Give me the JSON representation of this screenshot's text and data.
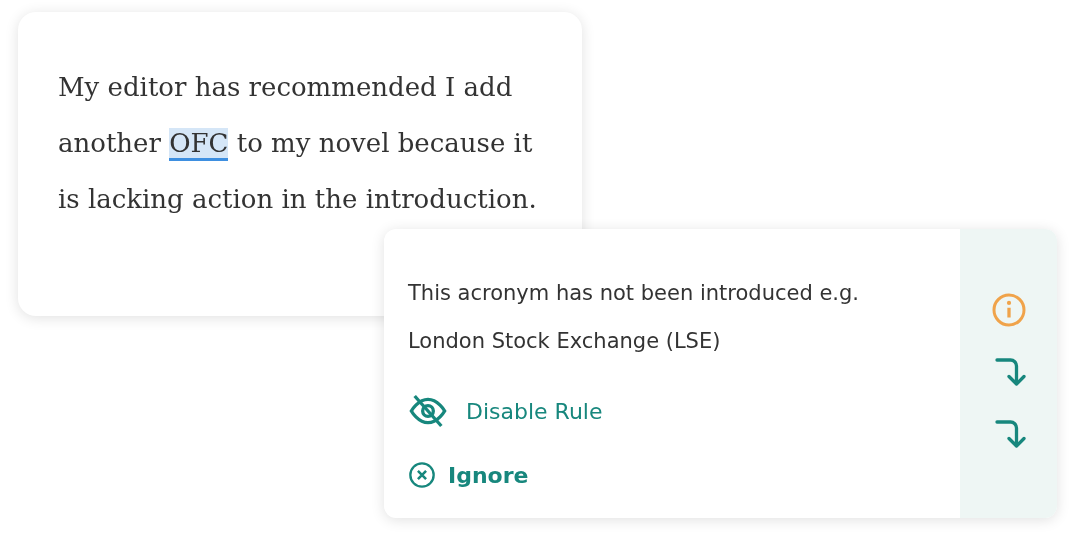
{
  "editor": {
    "segments": [
      {
        "text": "My editor has recommended I add another ",
        "highlighted": false
      },
      {
        "text": "OFC",
        "highlighted": true
      },
      {
        "text": " to my novel because it is lacking action in the introduction.",
        "highlighted": false
      }
    ]
  },
  "suggestion": {
    "message": "This acronym has not been introduced e.g. London Stock Exchange (LSE)",
    "actions": [
      {
        "kind": "disable",
        "label": "Disable Rule"
      },
      {
        "kind": "ignore",
        "label": "Ignore"
      }
    ],
    "side_icons": [
      {
        "kind": "info"
      },
      {
        "kind": "jump"
      },
      {
        "kind": "jump"
      }
    ]
  }
}
